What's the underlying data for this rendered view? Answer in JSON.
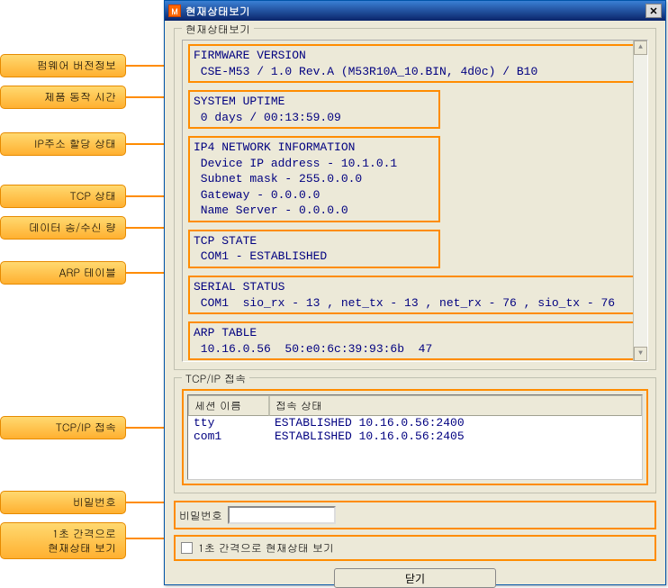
{
  "callouts": {
    "firmware": "펌웨어 버전정보",
    "uptime": "제품 동작 시간",
    "ipinfo": "IP주소 할당 상태",
    "tcpstate": "TCP 상태",
    "serial": "데이터 송/수신 량",
    "arp": "ARP 테이블",
    "tcpip": "TCP/IP 접속",
    "password": "비밀번호",
    "interval": "1초 간격으로\n현재상태 보기"
  },
  "window": {
    "title": "현재상태보기",
    "groupbox_label": "현재상태보기"
  },
  "status": {
    "firmware_hdr": "FIRMWARE VERSION",
    "firmware_val": " CSE-M53 / 1.0 Rev.A (M53R10A_10.BIN, 4d0c) / B10",
    "uptime_hdr": "SYSTEM UPTIME",
    "uptime_val": " 0 days / 00:13:59.09",
    "ip_hdr": "IP4 NETWORK INFORMATION",
    "ip_device": " Device IP address - 10.1.0.1",
    "ip_subnet": " Subnet mask - 255.0.0.0",
    "ip_gateway": " Gateway - 0.0.0.0",
    "ip_dns": " Name Server - 0.0.0.0",
    "tcp_hdr": "TCP STATE",
    "tcp_val": " COM1 - ESTABLISHED",
    "serial_hdr": "SERIAL STATUS",
    "serial_val": " COM1  sio_rx - 13 , net_tx - 13 , net_rx - 76 , sio_tx - 76",
    "arp_hdr": "ARP TABLE",
    "arp_val": " 10.16.0.56  50:e0:6c:39:93:6b  47"
  },
  "tcpip": {
    "group_label": "TCP/IP 접속",
    "col_session": "세션 이름",
    "col_status": "접속 상태",
    "rows": [
      {
        "name": " tty",
        "status": "ESTABLISHED 10.16.0.56:2400"
      },
      {
        "name": " com1",
        "status": "ESTABLISHED 10.16.0.56:2405"
      }
    ]
  },
  "password": {
    "label": "비밀번호",
    "value": ""
  },
  "interval": {
    "label": "1초 간격으로 현재상태 보기"
  },
  "close_btn": "닫기"
}
